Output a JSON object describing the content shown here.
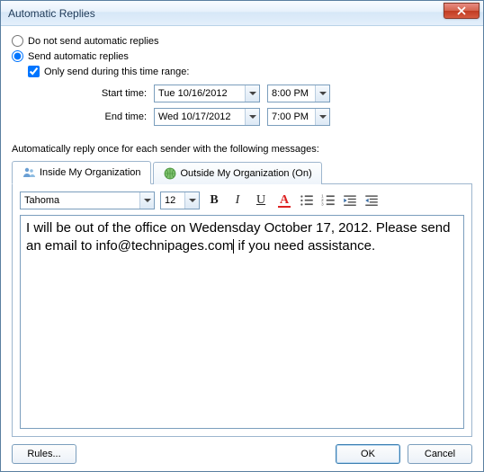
{
  "window": {
    "title": "Automatic Replies"
  },
  "options": {
    "do_not_send_label": "Do not send automatic replies",
    "send_label": "Send automatic replies",
    "only_during_label": "Only send during this time range:"
  },
  "time_range": {
    "start_label": "Start time:",
    "start_date": "Tue 10/16/2012",
    "start_time": "8:00 PM",
    "end_label": "End time:",
    "end_date": "Wed 10/17/2012",
    "end_time": "7:00 PM"
  },
  "section_label": "Automatically reply once for each sender with the following messages:",
  "tabs": {
    "inside_label": "Inside My Organization",
    "outside_label": "Outside My Organization (On)"
  },
  "editor": {
    "font_name": "Tahoma",
    "font_size": "12",
    "body_part1": "I will be out of the office on Wedensday October 17, 2012. Please send an email to info@technipages.com",
    "body_part2": " if you need assistance."
  },
  "footer": {
    "rules_label": "Rules...",
    "ok_label": "OK",
    "cancel_label": "Cancel"
  }
}
